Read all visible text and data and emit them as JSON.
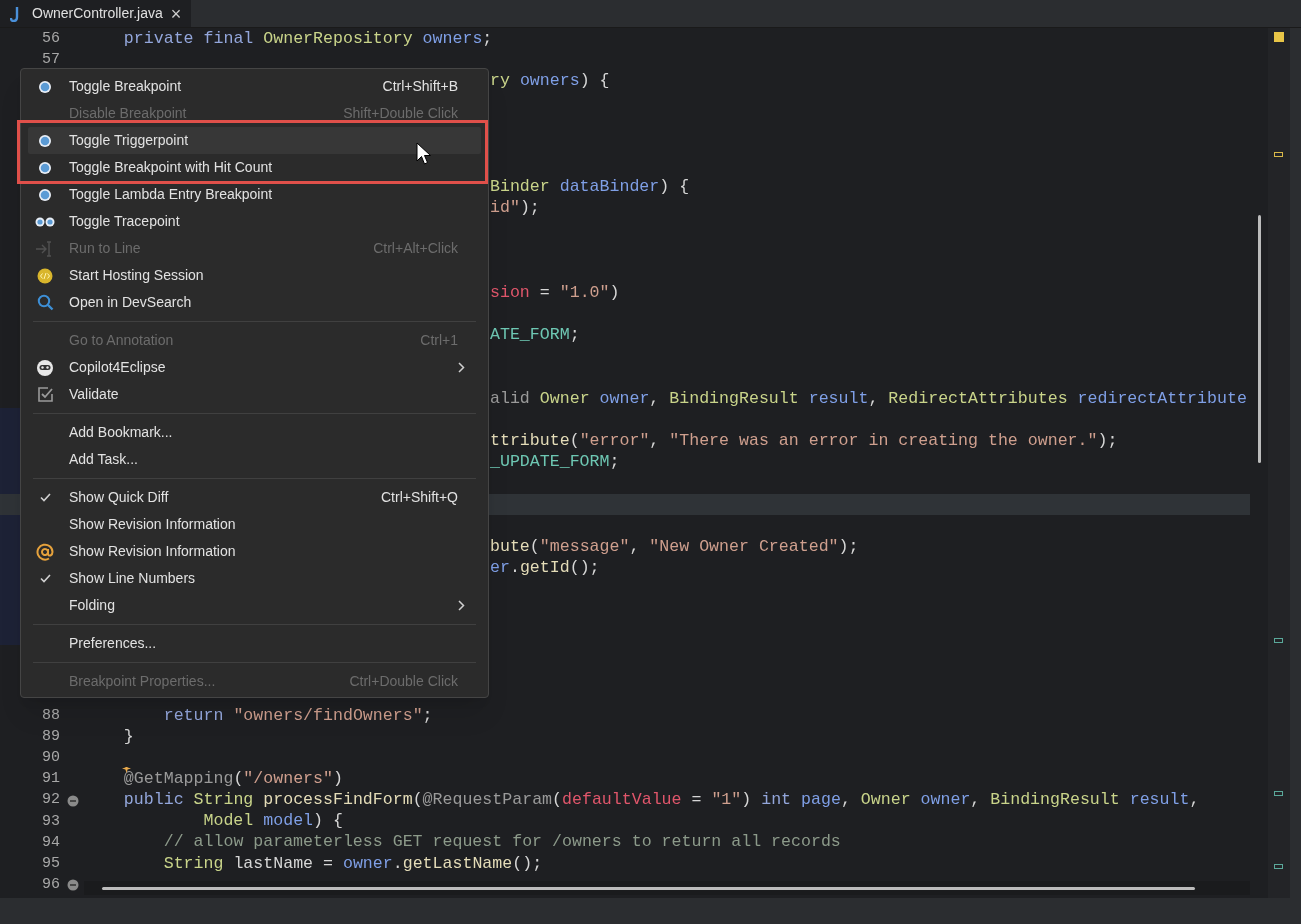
{
  "tab": {
    "title": "OwnerController.java",
    "close": "×",
    "selected": true
  },
  "lines": [
    {
      "kind": "code",
      "number": "56",
      "current": false,
      "tokens": [
        {
          "text": "    private final ",
          "kind": "keyword"
        },
        {
          "text": "OwnerRepository",
          "kind": "type"
        },
        {
          "text": " owners",
          "kind": "variable"
        },
        {
          "text": ";",
          "kind": "plain"
        }
      ]
    },
    {
      "kind": "code",
      "number": "57",
      "current": false
    },
    {
      "kind": "covered",
      "current": false,
      "tokens": [
        {
          "text": "ry",
          "kind": "type"
        },
        {
          "text": " owners",
          "kind": "variable"
        },
        {
          "text": ") {",
          "kind": "plain"
        }
      ]
    },
    {
      "kind": "covered",
      "current": false
    },
    {
      "kind": "covered",
      "current": false
    },
    {
      "kind": "covered",
      "current": false
    },
    {
      "kind": "covered",
      "current": false
    },
    {
      "kind": "covered",
      "current": false,
      "tokens": [
        {
          "text": "Binder",
          "kind": "type"
        },
        {
          "text": " dataBinder",
          "kind": "variable"
        },
        {
          "text": ") {",
          "kind": "plain"
        }
      ]
    },
    {
      "kind": "covered",
      "current": false,
      "tokens": [
        {
          "text": "id\"",
          "kind": "string"
        },
        {
          "text": ");",
          "kind": "plain"
        }
      ]
    },
    {
      "kind": "covered",
      "current": false
    },
    {
      "kind": "covered",
      "current": false
    },
    {
      "kind": "covered",
      "current": false
    },
    {
      "kind": "covered",
      "current": false,
      "tokens": [
        {
          "text": "sion",
          "kind": "param"
        },
        {
          "text": " = ",
          "kind": "plain"
        },
        {
          "text": "\"1.0\"",
          "kind": "string"
        },
        {
          "text": ")",
          "kind": "plain"
        }
      ]
    },
    {
      "kind": "covered",
      "current": false
    },
    {
      "kind": "covered",
      "current": false,
      "tokens": [
        {
          "text": "ATE_FORM",
          "kind": "constant"
        },
        {
          "text": ";",
          "kind": "plain"
        }
      ]
    },
    {
      "kind": "covered",
      "current": false
    },
    {
      "kind": "covered",
      "current": false
    },
    {
      "kind": "covered",
      "current": false,
      "tokens": [
        {
          "text": "alid",
          "kind": "annotation"
        },
        {
          "text": " Owner",
          "kind": "type"
        },
        {
          "text": " owner",
          "kind": "variable"
        },
        {
          "text": ", ",
          "kind": "plain"
        },
        {
          "text": "BindingResult",
          "kind": "type"
        },
        {
          "text": " result",
          "kind": "variable"
        },
        {
          "text": ", ",
          "kind": "plain"
        },
        {
          "text": "RedirectAttributes",
          "kind": "type"
        },
        {
          "text": " redirectAttribute",
          "kind": "variable"
        }
      ]
    },
    {
      "kind": "covered",
      "current": false
    },
    {
      "kind": "covered",
      "current": false,
      "tokens": [
        {
          "text": "ttribute",
          "kind": "method"
        },
        {
          "text": "(",
          "kind": "plain"
        },
        {
          "text": "\"error\"",
          "kind": "string"
        },
        {
          "text": ", ",
          "kind": "plain"
        },
        {
          "text": "\"There was an error in creating the owner.\"",
          "kind": "string"
        },
        {
          "text": ");",
          "kind": "plain"
        }
      ]
    },
    {
      "kind": "covered",
      "current": false,
      "tokens": [
        {
          "text": "_UPDATE_FORM",
          "kind": "constant"
        },
        {
          "text": ";",
          "kind": "plain"
        }
      ]
    },
    {
      "kind": "covered",
      "current": false
    },
    {
      "kind": "covered",
      "current": true
    },
    {
      "kind": "covered",
      "current": false
    },
    {
      "kind": "covered",
      "current": false,
      "tokens": [
        {
          "text": "bute",
          "kind": "method"
        },
        {
          "text": "(",
          "kind": "plain"
        },
        {
          "text": "\"message\"",
          "kind": "string"
        },
        {
          "text": ", ",
          "kind": "plain"
        },
        {
          "text": "\"New Owner Created\"",
          "kind": "string"
        },
        {
          "text": ");",
          "kind": "plain"
        }
      ]
    },
    {
      "kind": "covered",
      "current": false,
      "tokens": [
        {
          "text": "er",
          "kind": "variable"
        },
        {
          "text": ".",
          "kind": "plain"
        },
        {
          "text": "getId",
          "kind": "method"
        },
        {
          "text": "();",
          "kind": "plain"
        }
      ]
    },
    {
      "kind": "covered",
      "current": false
    },
    {
      "kind": "covered",
      "current": false
    },
    {
      "kind": "covered",
      "current": false
    },
    {
      "kind": "covered",
      "current": false
    },
    {
      "kind": "covered",
      "current": false
    },
    {
      "kind": "covered",
      "current": false
    },
    {
      "kind": "code",
      "number": "88",
      "current": false,
      "tokens": [
        {
          "text": "        return ",
          "kind": "keyword"
        },
        {
          "text": "\"owners/findOwners\"",
          "kind": "string"
        },
        {
          "text": ";",
          "kind": "plain"
        }
      ]
    },
    {
      "kind": "code",
      "number": "89",
      "current": false,
      "tokens": [
        {
          "text": "    }",
          "kind": "plain"
        }
      ]
    },
    {
      "kind": "code",
      "number": "90",
      "current": false
    },
    {
      "kind": "code",
      "number": "91",
      "current": false,
      "marker": {
        "kind": "star"
      },
      "tokens": [
        {
          "text": "    @GetMapping",
          "kind": "annotation"
        },
        {
          "text": "(",
          "kind": "plain"
        },
        {
          "text": "\"/owners\"",
          "kind": "string"
        },
        {
          "text": ")",
          "kind": "plain"
        }
      ]
    },
    {
      "kind": "code",
      "number": "92",
      "current": false,
      "marker": {
        "kind": "fold"
      },
      "tokens": [
        {
          "text": "    public ",
          "kind": "keyword"
        },
        {
          "text": "String",
          "kind": "type"
        },
        {
          "text": " processFindForm",
          "kind": "method"
        },
        {
          "text": "(",
          "kind": "plain"
        },
        {
          "text": "@RequestParam",
          "kind": "annotation"
        },
        {
          "text": "(",
          "kind": "plain"
        },
        {
          "text": "defaultValue",
          "kind": "param"
        },
        {
          "text": " = ",
          "kind": "plain"
        },
        {
          "text": "\"1\"",
          "kind": "string"
        },
        {
          "text": ") ",
          "kind": "plain"
        },
        {
          "text": "int",
          "kind": "keyword"
        },
        {
          "text": " page",
          "kind": "variable"
        },
        {
          "text": ", ",
          "kind": "plain"
        },
        {
          "text": "Owner",
          "kind": "type"
        },
        {
          "text": " owner",
          "kind": "variable"
        },
        {
          "text": ", ",
          "kind": "plain"
        },
        {
          "text": "BindingResult",
          "kind": "type"
        },
        {
          "text": " result",
          "kind": "variable"
        },
        {
          "text": ",",
          "kind": "plain"
        }
      ]
    },
    {
      "kind": "code",
      "number": "93",
      "current": false,
      "tokens": [
        {
          "text": "            Model",
          "kind": "type"
        },
        {
          "text": " model",
          "kind": "variable"
        },
        {
          "text": ") {",
          "kind": "plain"
        }
      ]
    },
    {
      "kind": "code",
      "number": "94",
      "current": false,
      "tokens": [
        {
          "text": "        // allow parameterless GET request for /owners to return all records",
          "kind": "comment"
        }
      ]
    },
    {
      "kind": "code",
      "number": "95",
      "current": false,
      "tokens": [
        {
          "text": "        String",
          "kind": "type"
        },
        {
          "text": " lastName = ",
          "kind": "plain"
        },
        {
          "text": "owner",
          "kind": "variable"
        },
        {
          "text": ".",
          "kind": "plain"
        },
        {
          "text": "getLastName",
          "kind": "method"
        },
        {
          "text": "();",
          "kind": "plain"
        }
      ]
    },
    {
      "kind": "code",
      "number": "96",
      "current": false,
      "marker": {
        "kind": "fold"
      }
    }
  ],
  "context_menu": {
    "items": [
      {
        "kind": "breakpoint",
        "label": "Toggle Breakpoint",
        "shortcut": "Ctrl+Shift+B",
        "disabled": false,
        "selected": false
      },
      {
        "kind": "plain",
        "label": "Disable Breakpoint",
        "shortcut": "Shift+Double Click",
        "disabled": true,
        "selected": false
      },
      {
        "kind": "breakpoint",
        "label": "Toggle Triggerpoint",
        "disabled": false,
        "selected": true
      },
      {
        "kind": "breakpoint",
        "label": "Toggle Breakpoint with Hit Count",
        "disabled": false,
        "selected": false
      },
      {
        "kind": "breakpoint",
        "label": "Toggle Lambda Entry Breakpoint",
        "disabled": false,
        "selected": false
      },
      {
        "kind": "tracepoint",
        "label": "Toggle Tracepoint",
        "disabled": false,
        "selected": false
      },
      {
        "kind": "run",
        "label": "Run to Line",
        "shortcut": "Ctrl+Alt+Click",
        "disabled": true,
        "selected": false
      },
      {
        "kind": "hosting",
        "label": "Start Hosting Session",
        "disabled": false,
        "selected": false
      },
      {
        "kind": "search",
        "label": "Open in DevSearch",
        "disabled": false,
        "selected": false
      },
      {
        "kind": "separator"
      },
      {
        "kind": "plain",
        "label": "Go to Annotation",
        "shortcut": "Ctrl+1",
        "disabled": true,
        "selected": false
      },
      {
        "kind": "copilot",
        "label": "Copilot4Eclipse",
        "submenu": true,
        "disabled": false,
        "selected": false
      },
      {
        "kind": "validate",
        "label": "Validate",
        "disabled": false,
        "selected": false
      },
      {
        "kind": "separator"
      },
      {
        "kind": "plain",
        "label": "Add Bookmark...",
        "disabled": false,
        "selected": false
      },
      {
        "kind": "plain",
        "label": "Add Task...",
        "disabled": false,
        "selected": false
      },
      {
        "kind": "separator"
      },
      {
        "kind": "toggle",
        "label": "Show Quick Diff",
        "shortcut": "Ctrl+Shift+Q",
        "checked": true,
        "disabled": false,
        "selected": false
      },
      {
        "kind": "toggle",
        "label": "Show Revision Information",
        "checked": false,
        "disabled": false,
        "selected": false
      },
      {
        "kind": "revision",
        "label": "Show Revision Information",
        "disabled": false,
        "selected": false
      },
      {
        "kind": "toggle",
        "label": "Show Line Numbers",
        "checked": true,
        "disabled": false,
        "selected": false
      },
      {
        "kind": "plain",
        "label": "Folding",
        "submenu": true,
        "disabled": false,
        "selected": false
      },
      {
        "kind": "separator"
      },
      {
        "kind": "plain",
        "label": "Preferences...",
        "disabled": false,
        "selected": false
      },
      {
        "kind": "separator"
      },
      {
        "kind": "plain",
        "label": "Breakpoint Properties...",
        "shortcut": "Ctrl+Double Click",
        "disabled": true,
        "selected": false
      }
    ]
  }
}
